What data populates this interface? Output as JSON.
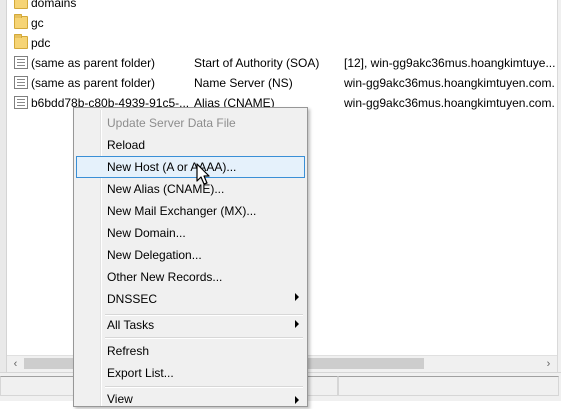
{
  "records": [
    {
      "icon": "folder-icon",
      "name": "domains",
      "type": "",
      "data": ""
    },
    {
      "icon": "folder-icon",
      "name": "gc",
      "type": "",
      "data": ""
    },
    {
      "icon": "folder-icon",
      "name": "pdc",
      "type": "",
      "data": ""
    },
    {
      "icon": "record-icon",
      "name": "(same as parent folder)",
      "type": "Start of Authority (SOA)",
      "data": "[12], win-gg9akc36mus.hoangkimtuye..."
    },
    {
      "icon": "record-icon",
      "name": "(same as parent folder)",
      "type": "Name Server (NS)",
      "data": "win-gg9akc36mus.hoangkimtuyen.com."
    },
    {
      "icon": "record-icon",
      "name": "b6bdd78b-c80b-4939-91c5-...",
      "type": "Alias (CNAME)",
      "data": "win-gg9akc36mus.hoangkimtuyen.com."
    }
  ],
  "context_menu": {
    "items": [
      {
        "label": "Update Server Data File",
        "enabled": false,
        "submenu": false,
        "highlighted": false
      },
      {
        "label": "Reload",
        "enabled": true,
        "submenu": false,
        "highlighted": false
      },
      {
        "label": "New Host (A or AAAA)...",
        "enabled": true,
        "submenu": false,
        "highlighted": true
      },
      {
        "label": "New Alias (CNAME)...",
        "enabled": true,
        "submenu": false,
        "highlighted": false
      },
      {
        "label": "New Mail Exchanger (MX)...",
        "enabled": true,
        "submenu": false,
        "highlighted": false
      },
      {
        "label": "New Domain...",
        "enabled": true,
        "submenu": false,
        "highlighted": false
      },
      {
        "label": "New Delegation...",
        "enabled": true,
        "submenu": false,
        "highlighted": false
      },
      {
        "label": "Other New Records...",
        "enabled": true,
        "submenu": false,
        "highlighted": false
      },
      {
        "label": "DNSSEC",
        "enabled": true,
        "submenu": true,
        "highlighted": false
      },
      {
        "label": "All Tasks",
        "enabled": true,
        "submenu": true,
        "highlighted": false
      },
      {
        "label": "Refresh",
        "enabled": true,
        "submenu": false,
        "highlighted": false
      },
      {
        "label": "Export List...",
        "enabled": true,
        "submenu": false,
        "highlighted": false
      },
      {
        "label": "View",
        "enabled": true,
        "submenu": true,
        "highlighted": false
      }
    ]
  },
  "scrollbar": {
    "left_arrow": "‹",
    "right_arrow": "›"
  },
  "colors": {
    "menu_highlight_bg": "#e5f1fb",
    "menu_highlight_border": "#3a8fd6",
    "disabled_text": "#8d8d8d"
  }
}
